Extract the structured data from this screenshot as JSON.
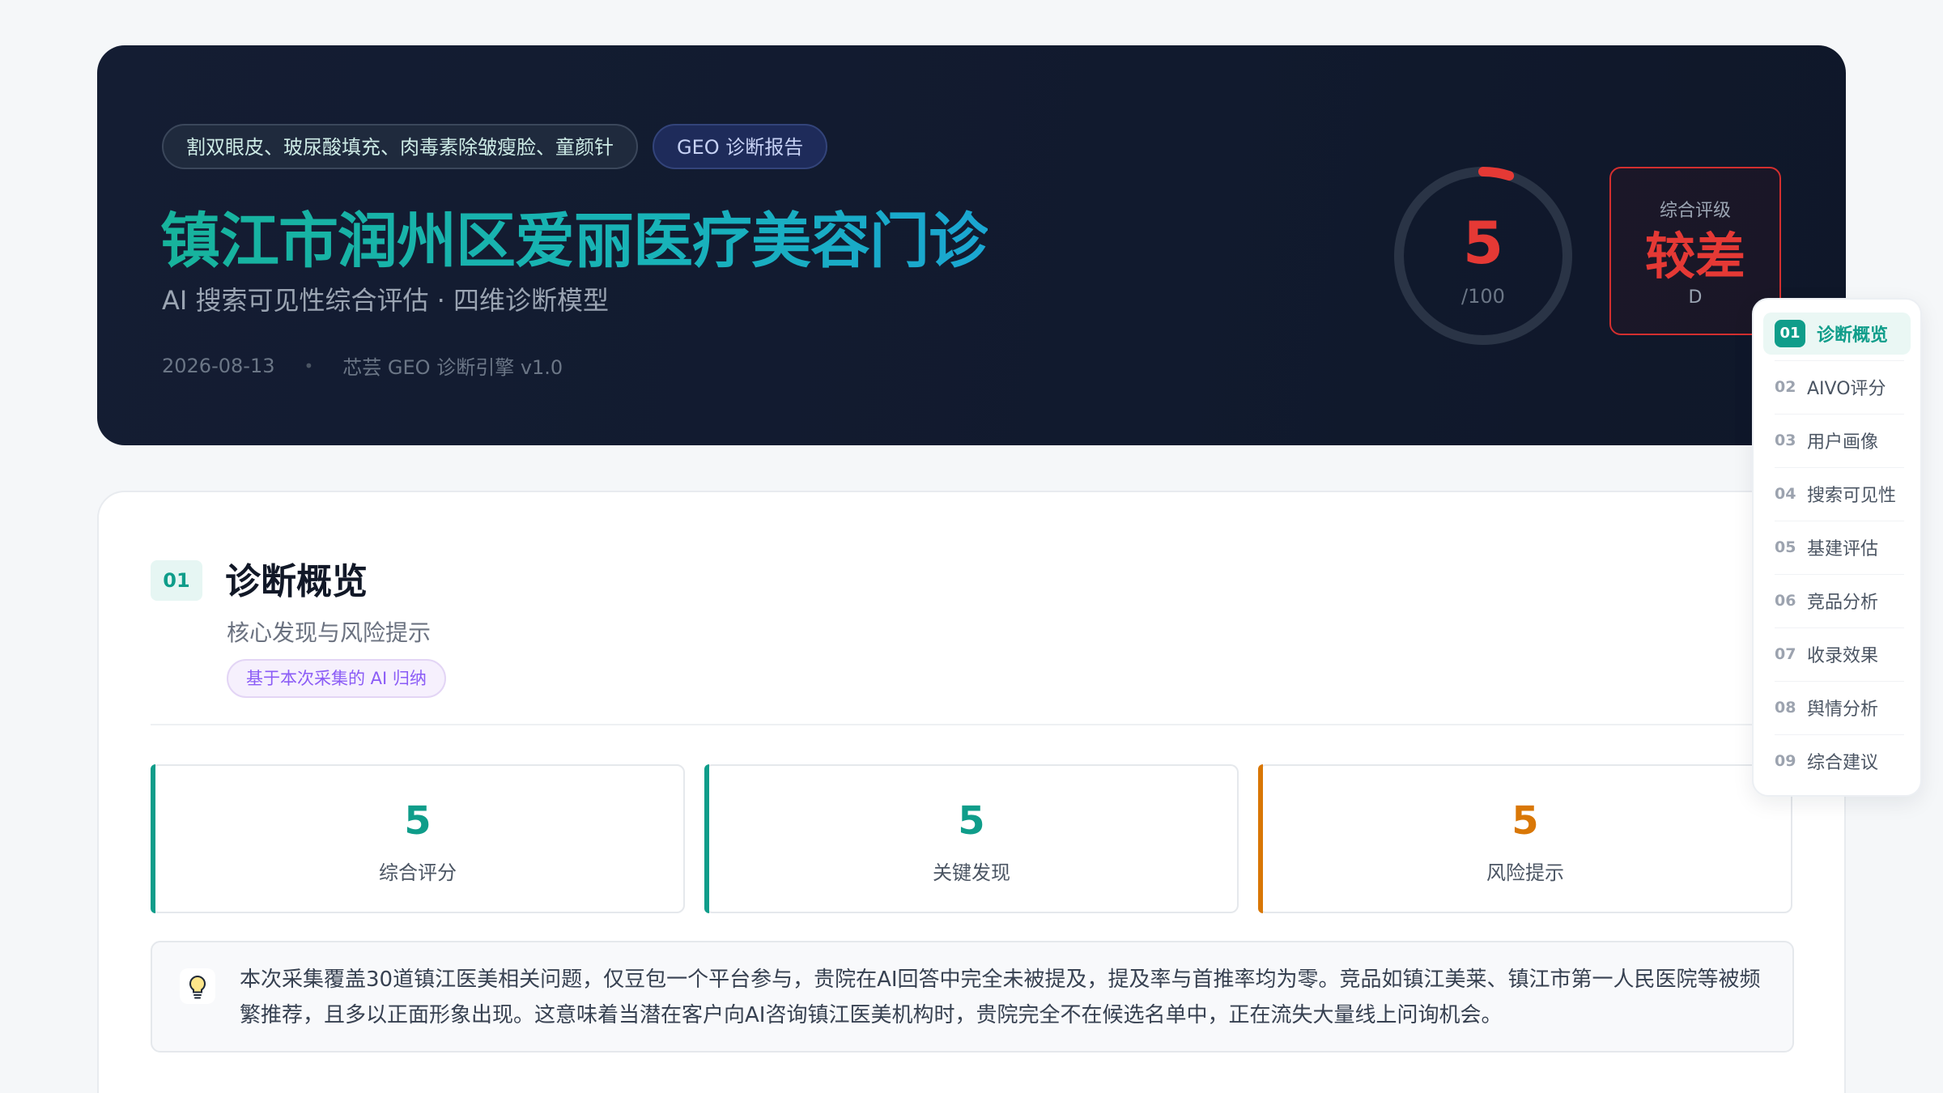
{
  "hero": {
    "keywords_tag": "割双眼皮、玻尿酸填充、肉毒素除皱瘦脸、童颜针",
    "report_tag": "GEO 诊断报告",
    "title": "镇江市润州区爱丽医疗美容门诊",
    "subtitle": "AI 搜索可见性综合评估 · 四维诊断模型",
    "date": "2026-08-13",
    "separator": "•",
    "engine": "芯芸 GEO 诊断引擎 v1.0",
    "score": {
      "value": "5",
      "max_label": "/100",
      "fraction": 0.05,
      "color": "#e53935"
    },
    "grade": {
      "label": "综合评级",
      "value": "较差",
      "letter": "D"
    }
  },
  "section": {
    "number": "01",
    "title": "诊断概览",
    "subtitle": "核心发现与风险提示",
    "ai_badge": "基于本次采集的 AI 归纳",
    "stats": [
      {
        "value": "5",
        "label": "综合评分",
        "color": "#0f9d8a"
      },
      {
        "value": "5",
        "label": "关键发现",
        "color": "#0f9d8a"
      },
      {
        "value": "5",
        "label": "风险提示",
        "color": "#d97706"
      }
    ],
    "insight_icon": "lightbulb-icon",
    "insight": "本次采集覆盖30道镇江医美相关问题，仅豆包一个平台参与，贵院在AI回答中完全未被提及，提及率与首推率均为零。竞品如镇江美莱、镇江市第一人民医院等被频繁推荐，且多以正面形象出现。这意味着当潜在客户向AI咨询镇江医美机构时，贵院完全不在候选名单中，正在流失大量线上问询机会。"
  },
  "toc": {
    "items": [
      {
        "num": "01",
        "label": "诊断概览",
        "active": true
      },
      {
        "num": "02",
        "label": "AIVO评分"
      },
      {
        "num": "03",
        "label": "用户画像"
      },
      {
        "num": "04",
        "label": "搜索可见性"
      },
      {
        "num": "05",
        "label": "基建评估"
      },
      {
        "num": "06",
        "label": "竞品分析"
      },
      {
        "num": "07",
        "label": "收录效果"
      },
      {
        "num": "08",
        "label": "舆情分析"
      },
      {
        "num": "09",
        "label": "综合建议"
      }
    ]
  },
  "colors": {
    "accent_teal": "#0f9d8a",
    "danger_red": "#e53935",
    "warning_orange": "#d97706",
    "hero_bg": "#121b30"
  }
}
